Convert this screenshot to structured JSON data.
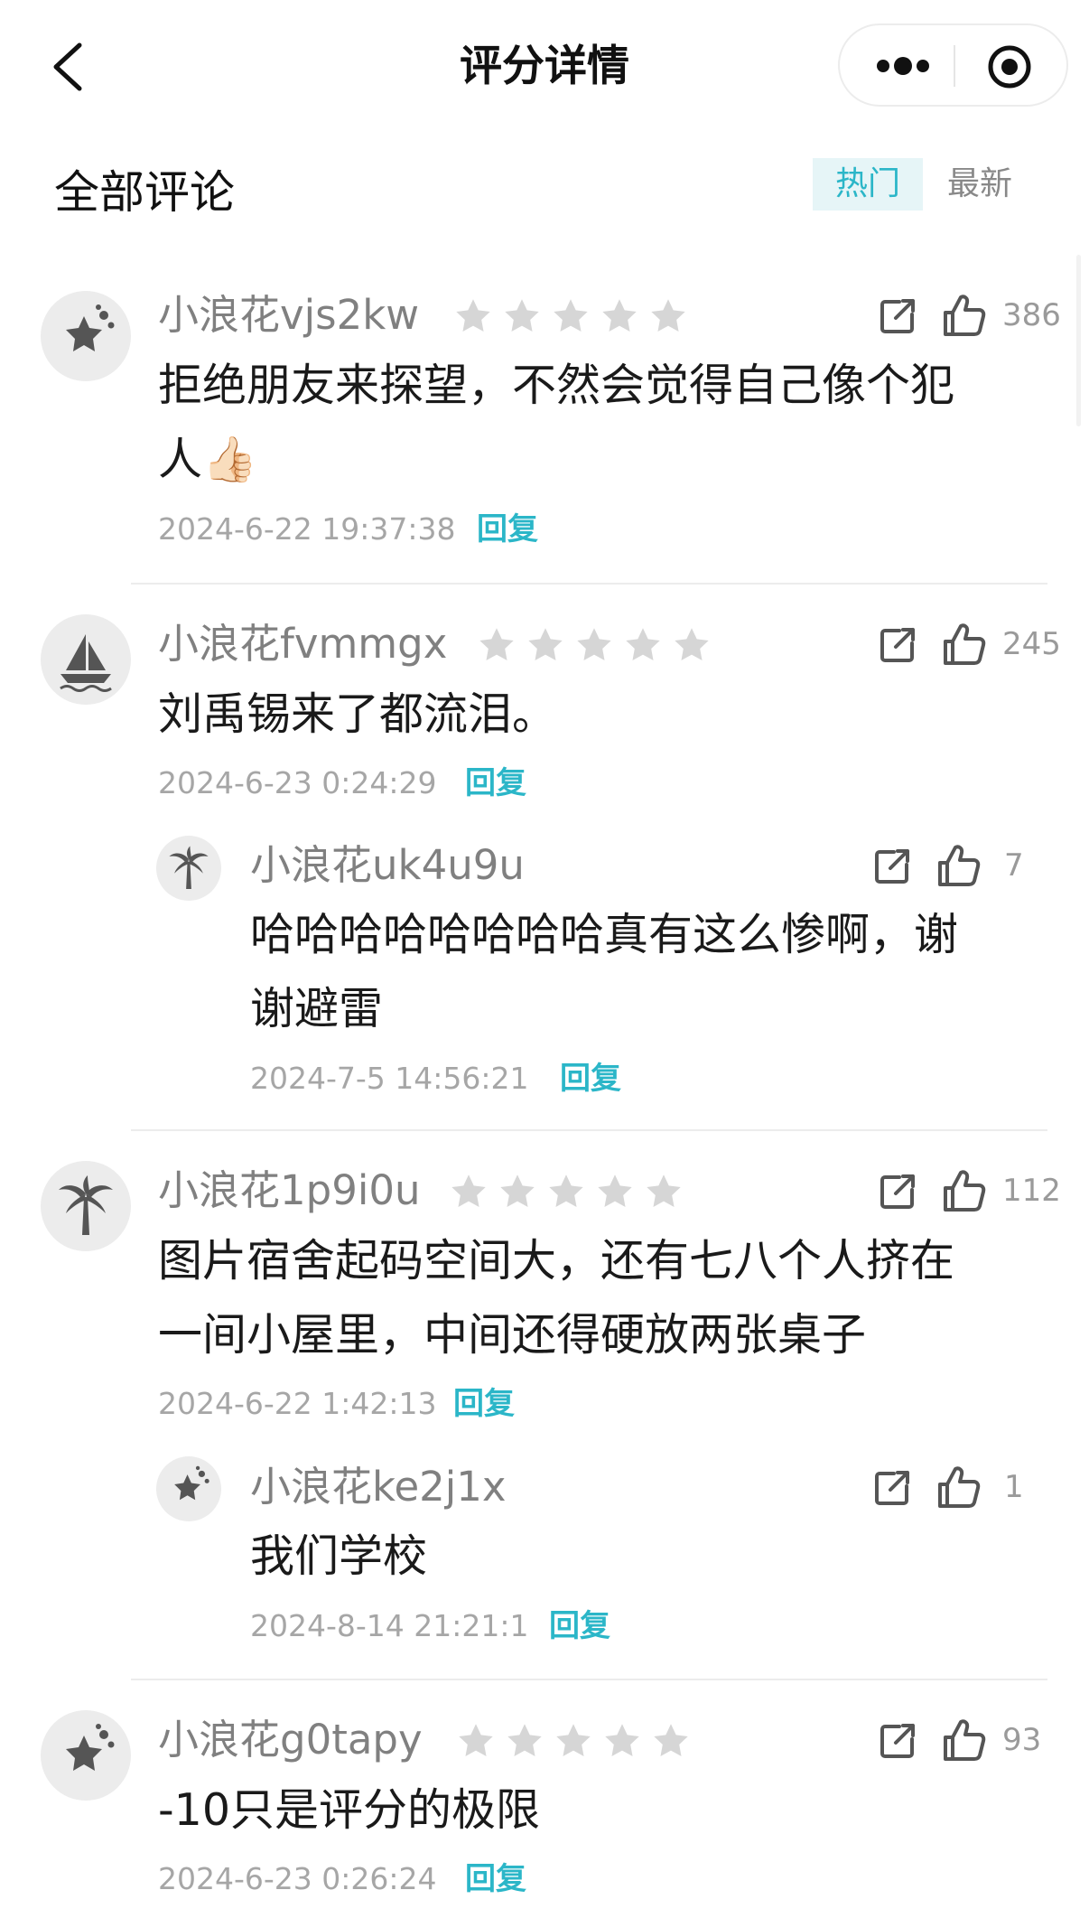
{
  "header": {
    "title": "评分详情",
    "back_icon": "chevron-left-icon",
    "more_icon": "more-dots-icon",
    "close_icon": "target-circle-icon"
  },
  "section": {
    "title": "全部评论",
    "tabs": [
      {
        "label": "热门",
        "active": true
      },
      {
        "label": "最新",
        "active": false
      }
    ]
  },
  "comments": [
    {
      "user": "小浪花vjs2kw",
      "avatar_icon": "star-sparkle-icon",
      "likes": "386",
      "content_lines": [
        "拒绝朋友来探望，不然会觉得自己像个犯",
        "人👍🏻"
      ],
      "time": "2024-6-22 19:37:38",
      "reply": "回复"
    },
    {
      "user": "小浪花fvmmgx",
      "avatar_icon": "sailboat-icon",
      "likes": "245",
      "content_lines": [
        "刘禹锡来了都流泪。"
      ],
      "time": "2024-6-23 0:24:29",
      "reply": "回复",
      "sub": {
        "user": "小浪花uk4u9u",
        "avatar_icon": "palm-tree-icon",
        "likes": "7",
        "content_lines": [
          "哈哈哈哈哈哈哈哈真有这么惨啊，谢",
          "谢避雷"
        ],
        "time": "2024-7-5 14:56:21",
        "reply": "回复"
      }
    },
    {
      "user": "小浪花1p9i0u",
      "avatar_icon": "palm-tree-icon",
      "likes": "112",
      "content_lines": [
        "图片宿舍起码空间大，还有七八个人挤在",
        "一间小屋里，中间还得硬放两张桌子"
      ],
      "time": "2024-6-22 1:42:13",
      "reply": "回复",
      "sub": {
        "user": "小浪花ke2j1x",
        "avatar_icon": "star-sparkle-icon",
        "likes": "1",
        "content_lines": [
          "我们学校"
        ],
        "time": "2024-8-14 21:21:1",
        "reply": "回复"
      }
    },
    {
      "user": "小浪花g0tapy",
      "avatar_icon": "star-sparkle-icon",
      "likes": "93",
      "content_lines": [
        "-10只是评分的极限"
      ],
      "time": "2024-6-23 0:26:24",
      "reply": "回复"
    }
  ],
  "colors": {
    "accent": "#2bb6c8",
    "tab_bg": "#e6f5f7",
    "star_gray": "#d4d4d4",
    "icon_gray": "#555555"
  }
}
